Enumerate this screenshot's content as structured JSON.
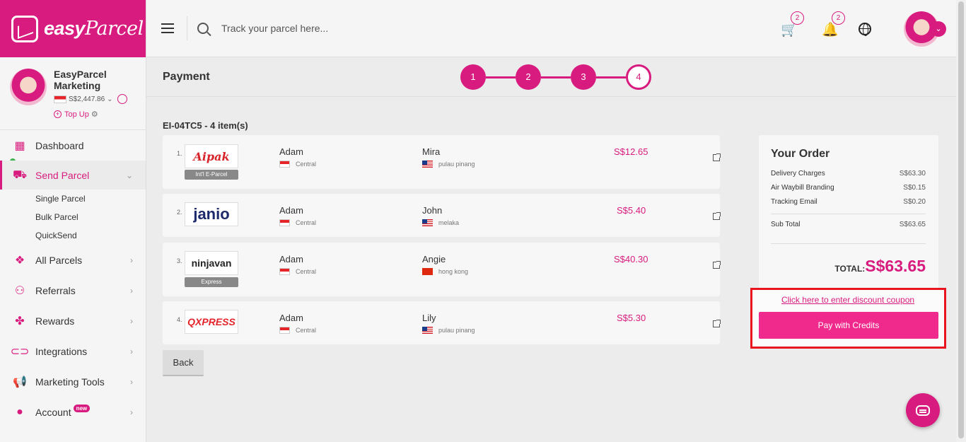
{
  "brand": {
    "logo_text": "easy",
    "logo_text2": "Parcel"
  },
  "profile": {
    "name": "EasyParcel Marketing",
    "balance": "S$2,447.86",
    "topup_label": "Top Up"
  },
  "sidebar": {
    "items": [
      {
        "label": "Dashboard",
        "icon": "dashboard-icon"
      },
      {
        "label": "Send Parcel",
        "icon": "truck-icon",
        "active": true
      },
      {
        "label": "All Parcels",
        "icon": "boxes-icon"
      },
      {
        "label": "Referrals",
        "icon": "users-plus-icon"
      },
      {
        "label": "Rewards",
        "icon": "gift-icon"
      },
      {
        "label": "Integrations",
        "icon": "link-icon"
      },
      {
        "label": "Marketing Tools",
        "icon": "megaphone-icon"
      },
      {
        "label": "Account",
        "icon": "user-icon",
        "badge": "new"
      }
    ],
    "send_parcel_sub": [
      "Single Parcel",
      "Bulk Parcel",
      "QuickSend"
    ]
  },
  "topbar": {
    "search_placeholder": "Track your parcel here...",
    "cart_count": "2",
    "notification_count": "2"
  },
  "page": {
    "title": "Payment",
    "steps": [
      "1",
      "2",
      "3",
      "4"
    ],
    "current_step": 4,
    "order_id": "EI-04TC5 - 4 item(s)"
  },
  "parcels": [
    {
      "num": "1.",
      "courier": "Aipak",
      "service": "Int'l E-Parcel",
      "sender": "Adam",
      "sender_loc": "Central",
      "receiver": "Mira",
      "receiver_loc": "pulau pinang",
      "receiver_flag": "my",
      "price": "S$12.65"
    },
    {
      "num": "2.",
      "courier": "janio",
      "service": "",
      "sender": "Adam",
      "sender_loc": "Central",
      "receiver": "John",
      "receiver_loc": "melaka",
      "receiver_flag": "my",
      "price": "S$5.40"
    },
    {
      "num": "3.",
      "courier": "ninjavan",
      "service": "Express",
      "sender": "Adam",
      "sender_loc": "Central",
      "receiver": "Angie",
      "receiver_loc": "hong kong",
      "receiver_flag": "hk",
      "price": "S$40.30"
    },
    {
      "num": "4.",
      "courier": "QXPRESS",
      "service": "",
      "sender": "Adam",
      "sender_loc": "Central",
      "receiver": "Lily",
      "receiver_loc": "pulau pinang",
      "receiver_flag": "my",
      "price": "S$5.30"
    }
  ],
  "back_label": "Back",
  "summary": {
    "title": "Your Order",
    "lines": [
      {
        "label": "Delivery Charges",
        "value": "S$63.30"
      },
      {
        "label": "Air Waybill Branding",
        "value": "S$0.15"
      },
      {
        "label": "Tracking Email",
        "value": "S$0.20"
      }
    ],
    "subtotal_label": "Sub Total",
    "subtotal_value": "S$63.65",
    "total_label": "TOTAL:",
    "total_value": "S$63.65",
    "coupon_link": "Click here to enter discount coupon",
    "pay_label": "Pay with Credits"
  },
  "colors": {
    "brand": "#d81b7e",
    "pay_button": "#ef2a8c",
    "highlight": "#e8151f"
  }
}
